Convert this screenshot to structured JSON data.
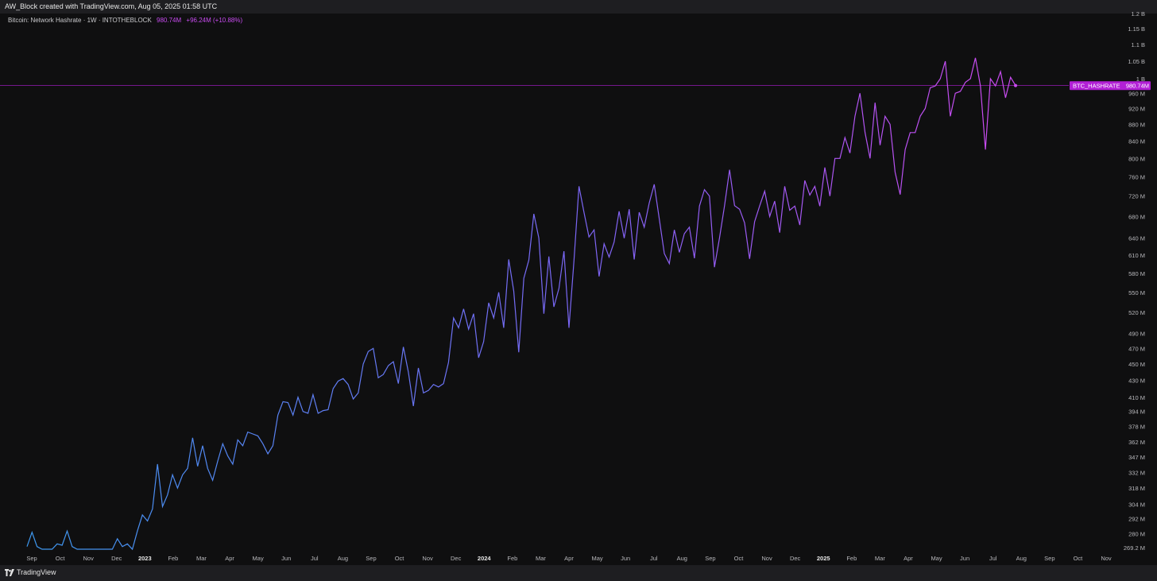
{
  "header": {
    "caption": "AW_Block created with TradingView.com, Aug 05, 2025 01:58 UTC"
  },
  "legend": {
    "title": "Bitcoin: Network Hashrate · 1W · INTOTHEBLOCK",
    "value": "980.74M",
    "change": "+96.24M (+10.88%)"
  },
  "footer": {
    "brand": "TradingView"
  },
  "colors": {
    "line_start": "#3a9bf0",
    "line_mid": "#7b66f5",
    "line_end": "#c84bf0",
    "badge": "#b21fd6"
  },
  "chart_data": {
    "type": "line",
    "title": "Bitcoin: Network Hashrate · 1W · INTOTHEBLOCK",
    "y_scale": "log",
    "ylim": [
      "269.2M",
      "1.2B"
    ],
    "y_ticks": [
      "1.2B",
      "1.15B",
      "1.1B",
      "1.05B",
      "1B",
      "960M",
      "920M",
      "880M",
      "840M",
      "800M",
      "760M",
      "720M",
      "680M",
      "640M",
      "610M",
      "580M",
      "550M",
      "520M",
      "490M",
      "470M",
      "450M",
      "430M",
      "410M",
      "394M",
      "378M",
      "362M",
      "347M",
      "332M",
      "318M",
      "304M",
      "292M",
      "280M",
      "269.2M"
    ],
    "x_ticks": [
      "Sep",
      "Oct",
      "Nov",
      "Dec",
      "2023",
      "Feb",
      "Mar",
      "Apr",
      "May",
      "Jun",
      "Jul",
      "Aug",
      "Sep",
      "Oct",
      "Nov",
      "Dec",
      "2024",
      "Feb",
      "Mar",
      "Apr",
      "May",
      "Jun",
      "Jul",
      "Aug",
      "Sep",
      "Oct",
      "Nov",
      "Dec",
      "2025",
      "Feb",
      "Mar",
      "Apr",
      "May",
      "Jun",
      "Jul",
      "Aug",
      "Sep",
      "Oct",
      "Nov"
    ],
    "x_ticks_bold": [
      "2023",
      "2024",
      "2025"
    ],
    "series": [
      {
        "name": "BTC_HASHRATE",
        "last_value_label": "980.74M",
        "values": [
          270,
          281,
          270,
          267,
          262,
          264,
          272,
          271,
          282,
          270,
          265,
          268,
          258,
          260,
          261,
          262,
          264,
          262,
          276,
          270,
          272,
          268,
          282,
          295,
          290,
          300,
          340,
          302,
          312,
          330,
          318,
          330,
          336,
          366,
          338,
          358,
          336,
          325,
          343,
          360,
          348,
          340,
          364,
          358,
          372,
          370,
          368,
          360,
          350,
          358,
          390,
          405,
          404,
          390,
          410,
          394,
          392,
          413,
          392,
          395,
          396,
          420,
          429,
          432,
          425,
          408,
          415,
          450,
          466,
          470,
          433,
          437,
          448,
          453,
          426,
          472,
          440,
          400,
          445,
          415,
          418,
          425,
          422,
          426,
          452,
          512,
          498,
          525,
          496,
          518,
          458,
          479,
          534,
          512,
          550,
          498,
          603,
          552,
          465,
          572,
          602,
          685,
          640,
          518,
          608,
          528,
          556,
          617,
          498,
          601,
          740,
          688,
          642,
          655,
          575,
          630,
          607,
          633,
          690,
          640,
          694,
          603,
          688,
          660,
          706,
          744,
          675,
          613,
          596,
          655,
          615,
          648,
          660,
          605,
          700,
          733,
          720,
          590,
          640,
          700,
          775,
          701,
          694,
          668,
          604,
          670,
          700,
          730,
          680,
          710,
          650,
          740,
          692,
          700,
          664,
          752,
          722,
          740,
          700,
          780,
          720,
          800,
          800,
          848,
          812,
          900,
          960,
          860,
          800,
          935,
          830,
          900,
          880,
          770,
          723,
          820,
          860,
          860,
          900,
          920,
          975,
          980,
          1000,
          1050,
          900,
          960,
          965,
          990,
          1000,
          1060,
          980,
          820,
          1000,
          980,
          1020,
          948,
          1004,
          981
        ]
      }
    ],
    "horizontal_line_value": "980.74M",
    "grid": false
  }
}
